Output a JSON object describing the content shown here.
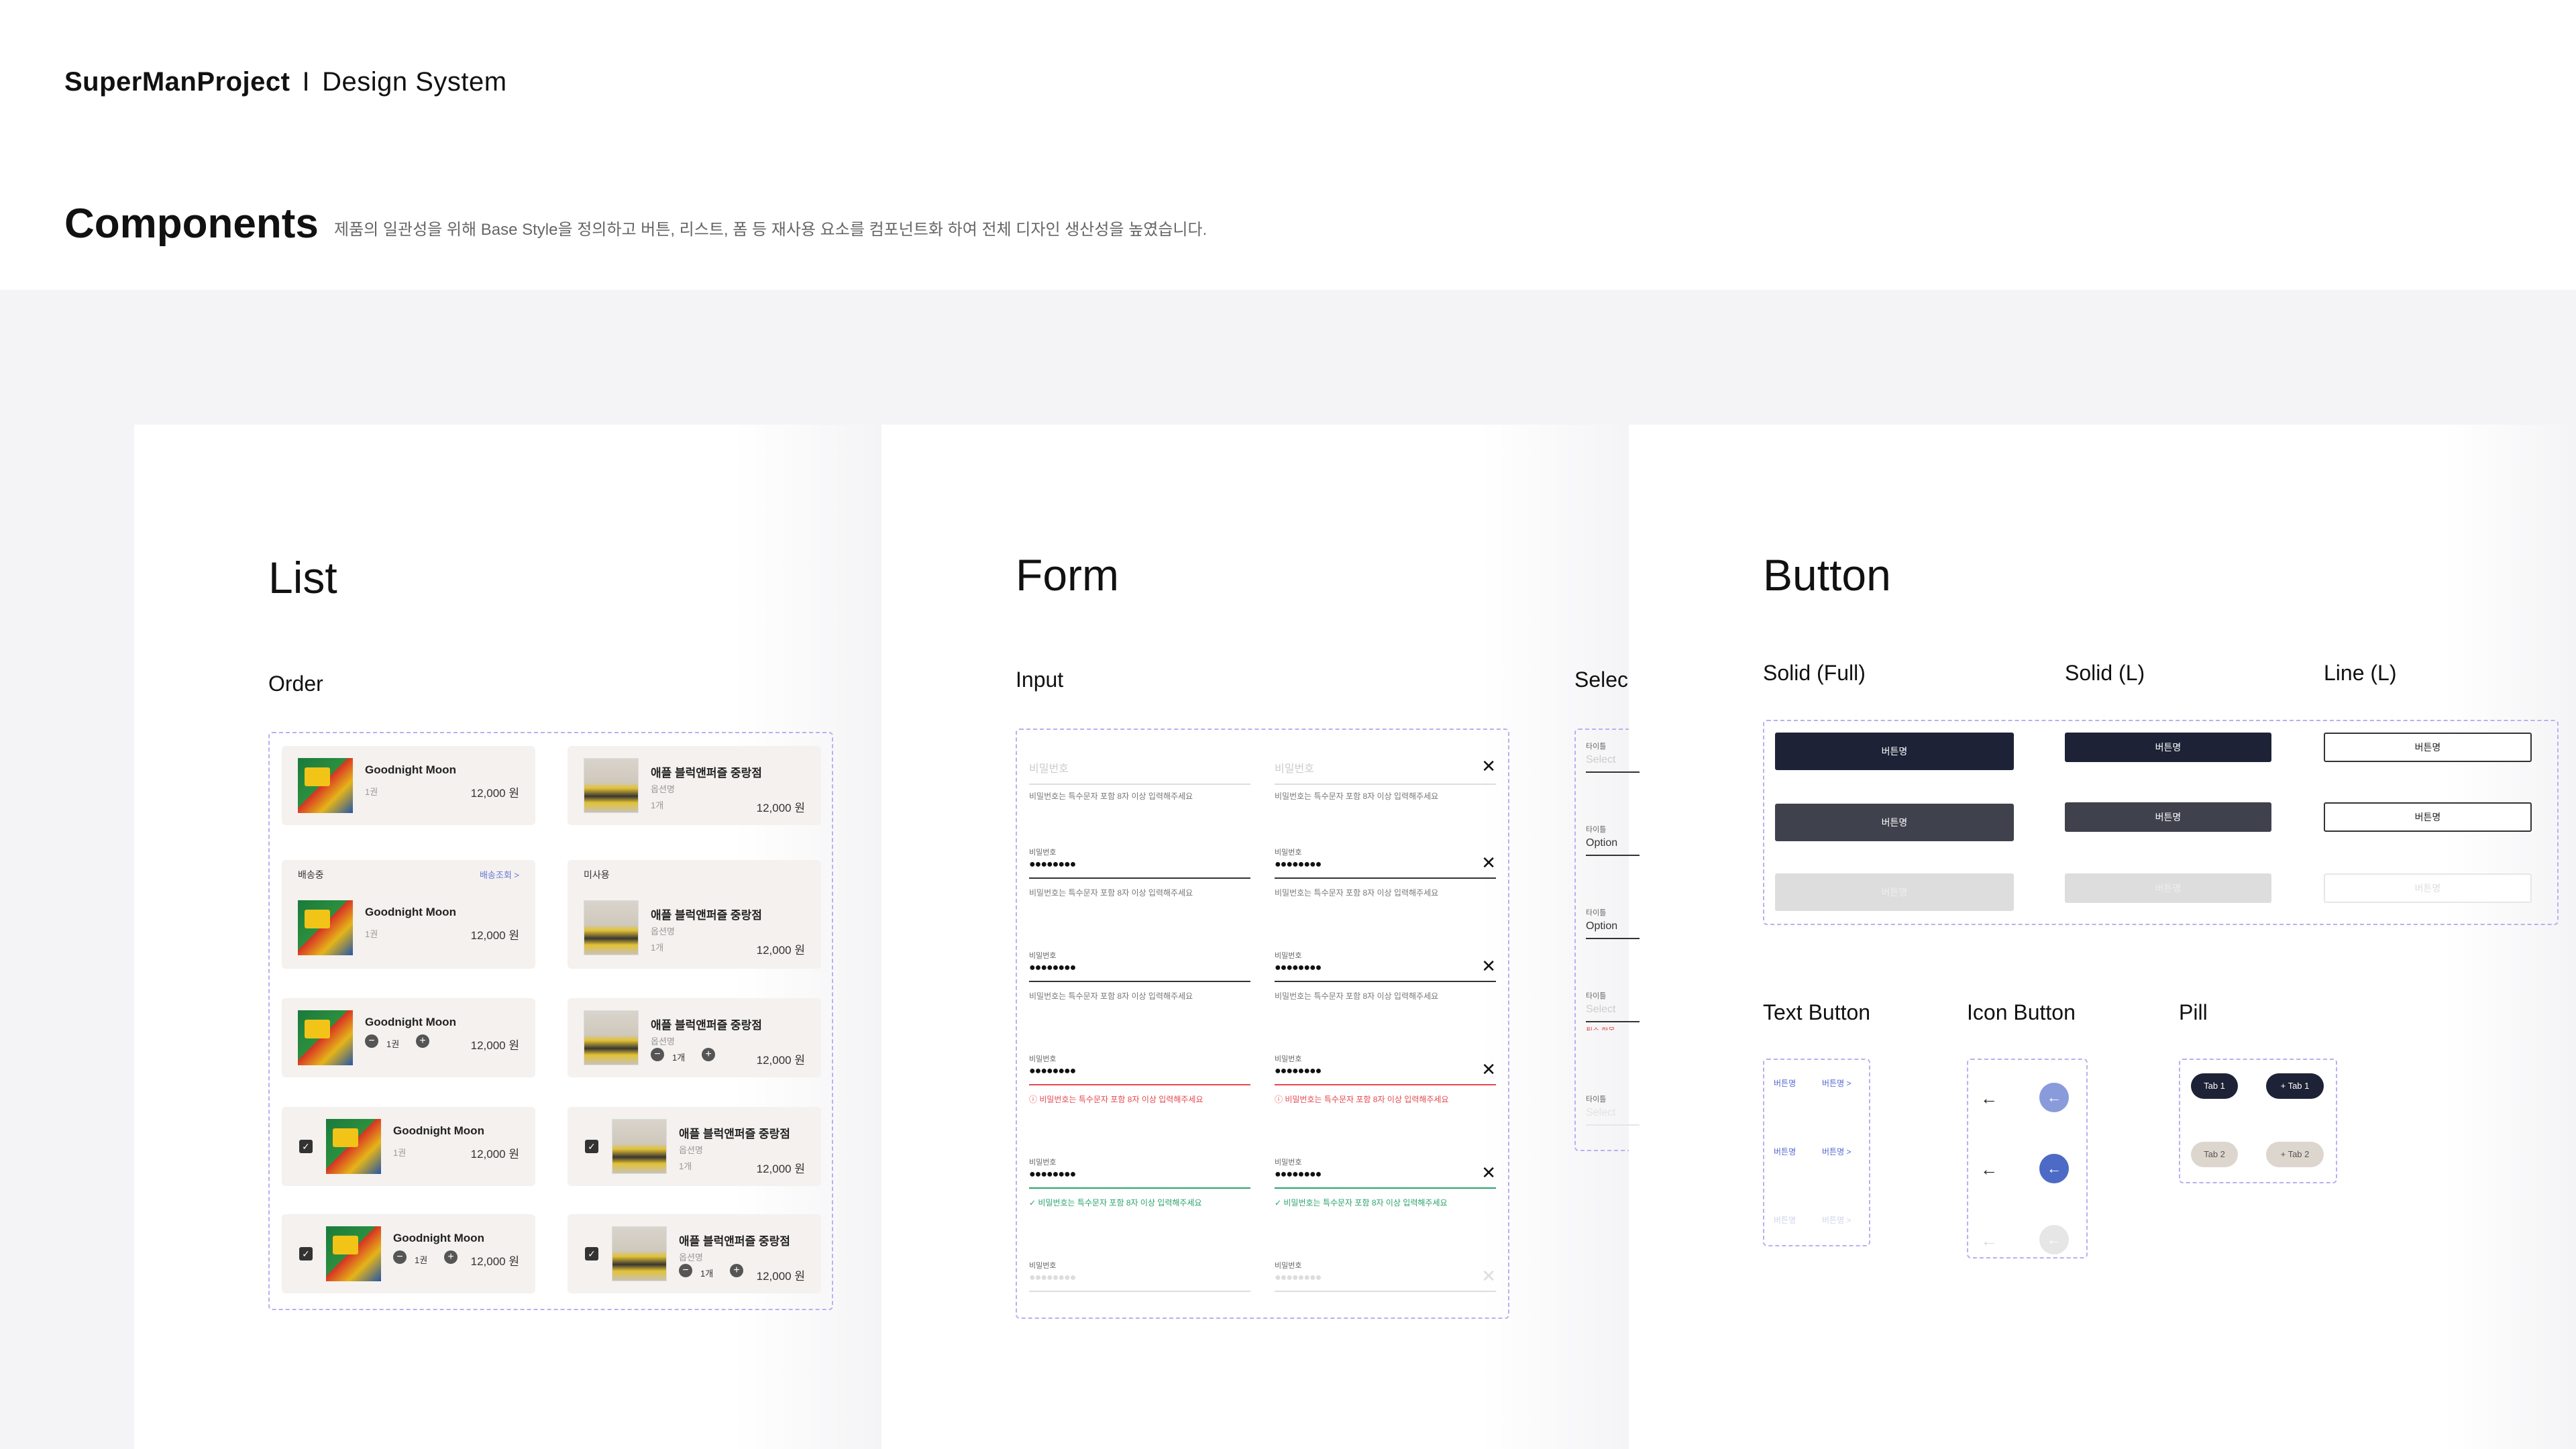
{
  "brand": {
    "project": "SuperManProject",
    "separator": "I",
    "system": "Design System"
  },
  "page": {
    "title": "Components",
    "description": "제품의 일관성을 위해 Base Style을 정의하고 버튼, 리스트, 폼 등 재사용 요소를 컴포넌트화 하여 전체 디자인 생산성을 높였습니다."
  },
  "list": {
    "title": "List",
    "subtitle": "Order",
    "book": {
      "title": "Goodnight Moon",
      "meta": "1권",
      "price": "12,000 원",
      "qty": "1권"
    },
    "puzzle": {
      "title": "애플 블럭앤퍼즐 중랑점",
      "option": "옵션명",
      "meta": "1개",
      "price": "12,000 원",
      "qty": "1개"
    },
    "status_shipping": "배송중",
    "status_link": "배송조회 >",
    "status_unused": "미사용"
  },
  "form": {
    "title": "Form",
    "input_title": "Input",
    "select_title": "Selec",
    "placeholder": "비밀번호",
    "label": "비밀번호",
    "help": "비밀번호는 특수문자 포함 8자 이상 입력해주세요",
    "dots": "●●●●●●●●",
    "select": {
      "label": "타이틀",
      "placeholder": "Select",
      "option": "Option",
      "error": "필수 항목"
    }
  },
  "button": {
    "title": "Button",
    "solid_full": "Solid (Full)",
    "solid_l": "Solid (L)",
    "line_l": "Line (L)",
    "label": "버튼명",
    "text_button": "Text Button",
    "icon_button": "Icon Button",
    "pill": "Pill",
    "text_label": "버튼명",
    "text_label_arrow": "버튼명 >",
    "pills": {
      "tab1": "Tab 1",
      "tab1_plus": "+ Tab 1",
      "tab2": "Tab 2",
      "tab2_plus": "+ Tab 2"
    }
  },
  "icons": {
    "close": "x-icon",
    "arrow": "arrow-left-icon",
    "check": "check-icon",
    "plus": "plus-icon",
    "minus": "minus-icon"
  },
  "colors": {
    "accent": "#5366d1",
    "dark": "#1d2236",
    "dashed": "#b9b0f2",
    "error": "#e5484d",
    "success": "#2aa36a"
  }
}
